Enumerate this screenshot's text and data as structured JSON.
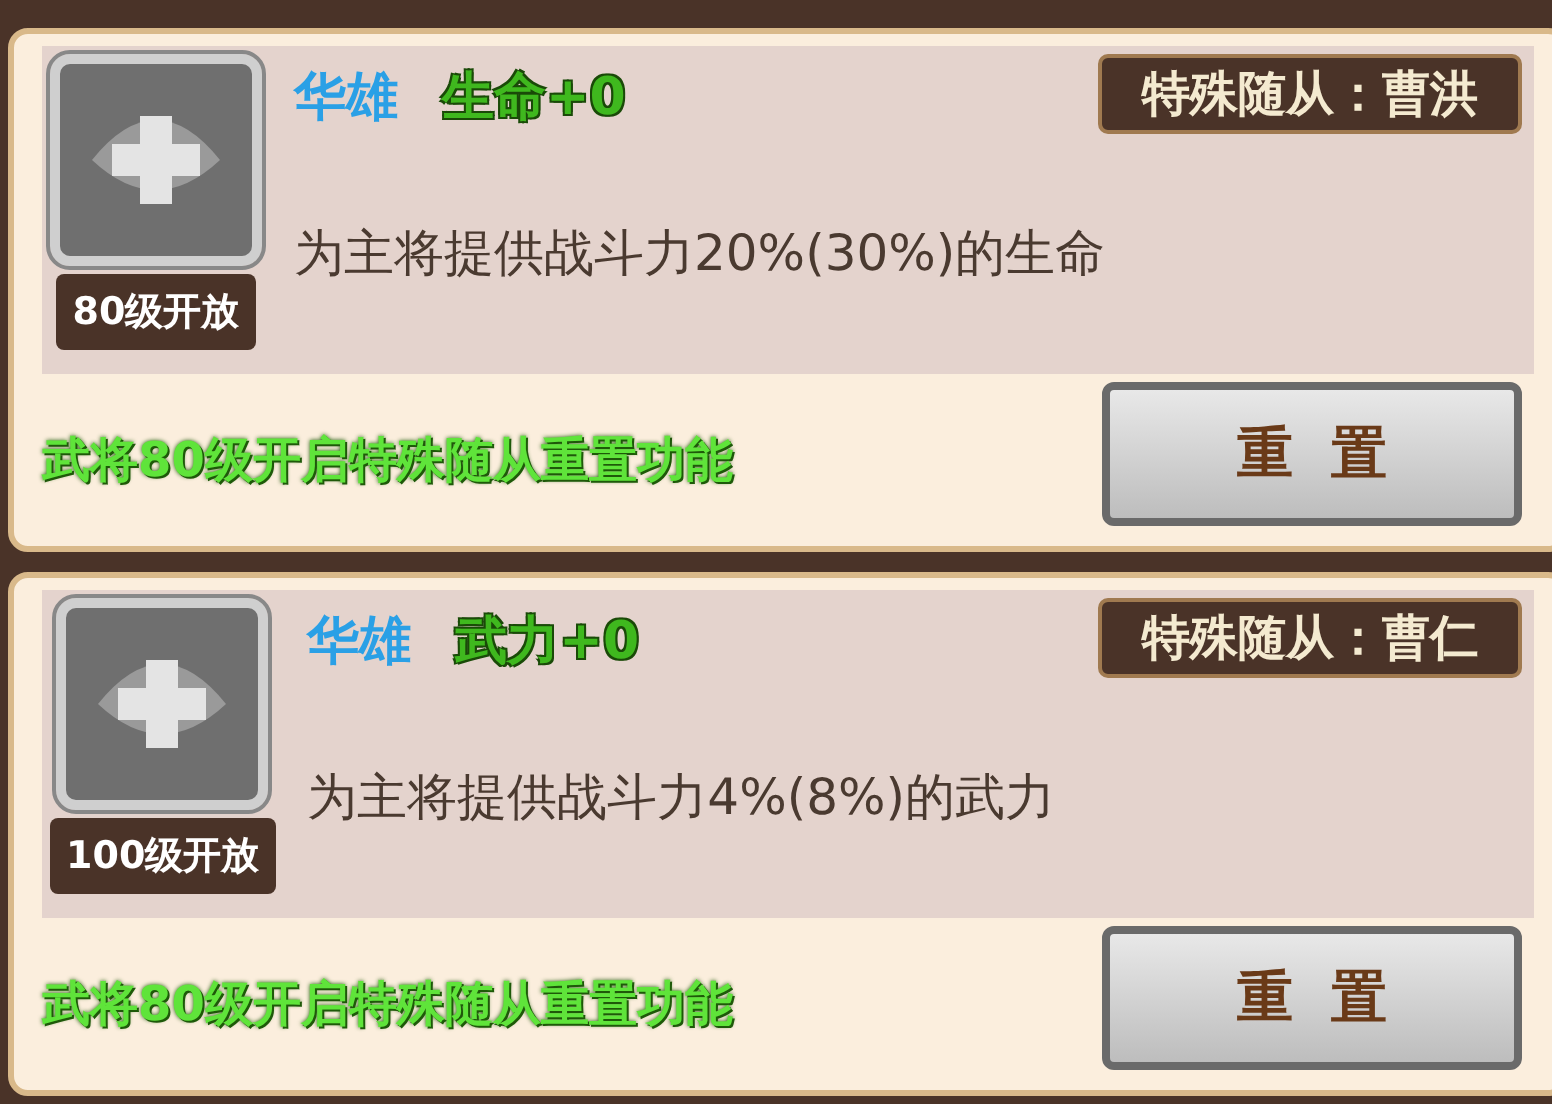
{
  "followers": [
    {
      "general": "华雄",
      "stat": "生命+0",
      "tag": "特殊随从：曹洪",
      "unlock": "80级开放",
      "description": "为主将提供战斗力20%(30%)的生命",
      "notice": "武将80级开启特殊随从重置功能",
      "button": "重  置"
    },
    {
      "general": "华雄",
      "stat": "武力+0",
      "tag": "特殊随从：曹仁",
      "unlock": "100级开放",
      "description": "为主将提供战斗力4%(8%)的武力",
      "notice": "武将80级开启特殊随从重置功能",
      "button": "重  置"
    }
  ]
}
